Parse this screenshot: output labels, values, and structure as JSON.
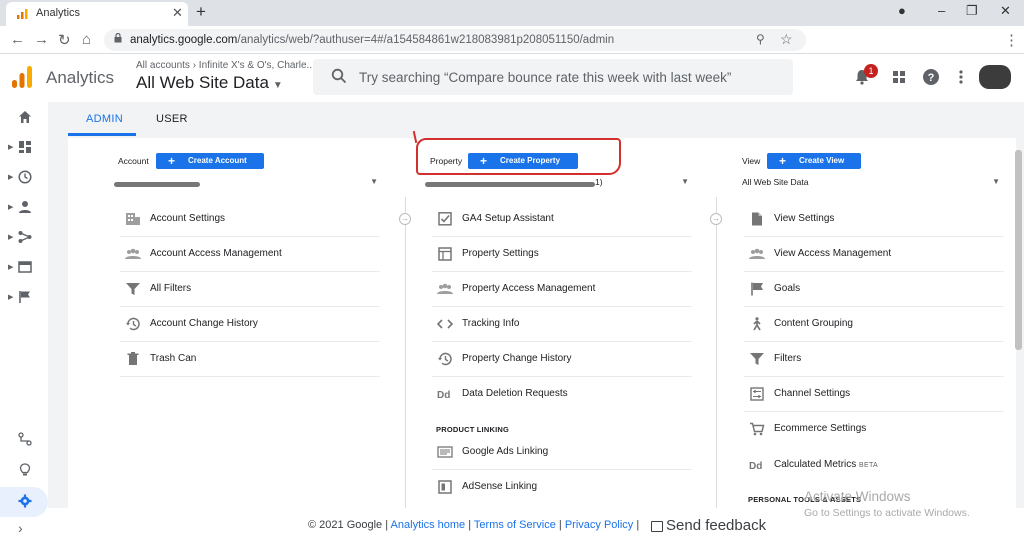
{
  "browser": {
    "tab_title": "Analytics",
    "url_host": "analytics.google.com",
    "url_path": "/analytics/web/?authuser=4#/a154584861w218083981p208051150/admin"
  },
  "header": {
    "product_name": "Analytics",
    "breadcrumb": "All accounts › Infinite X's & O's, Charle...",
    "view_name": "All Web Site Data",
    "search_placeholder": "Try searching “Compare bounce rate this week with last week”",
    "notification_count": "1"
  },
  "admin_tabs": [
    {
      "label": "ADMIN"
    },
    {
      "label": "USER"
    }
  ],
  "account": {
    "label": "Account",
    "button": "Create Account",
    "items": [
      {
        "label": "Account Settings",
        "icon": "building-icon"
      },
      {
        "label": "Account Access Management",
        "icon": "people-icon"
      },
      {
        "label": "All Filters",
        "icon": "filter-icon"
      },
      {
        "label": "Account Change History",
        "icon": "history-icon"
      },
      {
        "label": "Trash Can",
        "icon": "trash-icon"
      }
    ]
  },
  "property": {
    "label": "Property",
    "button": "Create Property",
    "select_suffix": "1)",
    "items": [
      {
        "label": "GA4 Setup Assistant",
        "icon": "checkbox-icon"
      },
      {
        "label": "Property Settings",
        "icon": "layout-icon"
      },
      {
        "label": "Property Access Management",
        "icon": "people-icon"
      },
      {
        "label": "Tracking Info",
        "icon": "code-icon"
      },
      {
        "label": "Property Change History",
        "icon": "history-icon"
      },
      {
        "label": "Data Deletion Requests",
        "icon": "dd-icon"
      }
    ],
    "section": "PRODUCT LINKING",
    "linking": [
      {
        "label": "Google Ads Linking",
        "icon": "ads-icon"
      },
      {
        "label": "AdSense Linking",
        "icon": "adsense-icon"
      }
    ]
  },
  "view": {
    "label": "View",
    "button": "Create View",
    "select_value": "All Web Site Data",
    "items": [
      {
        "label": "View Settings",
        "icon": "document-icon"
      },
      {
        "label": "View Access Management",
        "icon": "people-icon"
      },
      {
        "label": "Goals",
        "icon": "flag-icon"
      },
      {
        "label": "Content Grouping",
        "icon": "person-walk-icon"
      },
      {
        "label": "Filters",
        "icon": "filter-icon"
      },
      {
        "label": "Channel Settings",
        "icon": "sliders-icon"
      },
      {
        "label": "Ecommerce Settings",
        "icon": "cart-icon"
      },
      {
        "label": "Calculated Metrics",
        "icon": "dd-icon",
        "badge": "BETA"
      }
    ],
    "section": "PERSONAL TOOLS & ASSETS"
  },
  "footer": {
    "copyright": "© 2021 Google",
    "links": [
      "Analytics home",
      "Terms of Service",
      "Privacy Policy"
    ],
    "feedback": "Send feedback"
  },
  "watermark": {
    "title": "Activate Windows",
    "subtitle": "Go to Settings to activate Windows."
  },
  "colors": {
    "accent": "#1a73e8",
    "highlight": "#d32f2f"
  }
}
